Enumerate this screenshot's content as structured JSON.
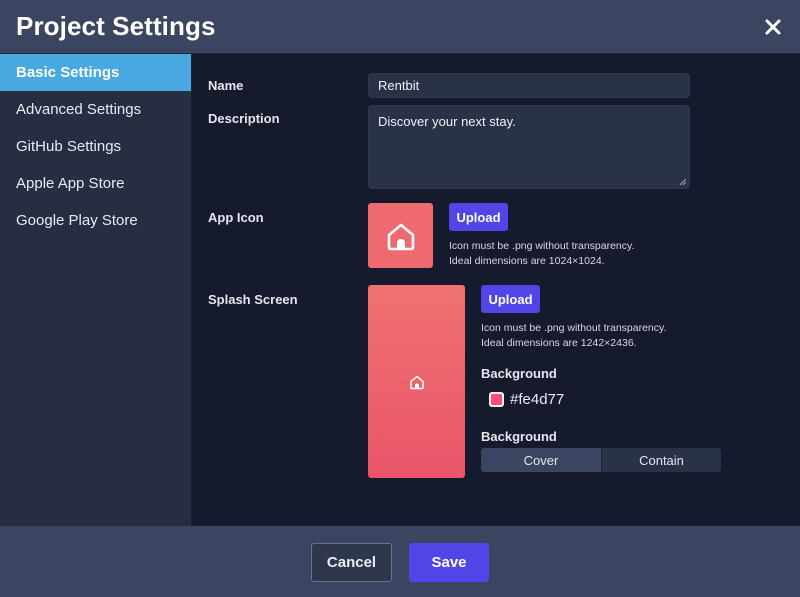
{
  "header": {
    "title": "Project Settings",
    "close_icon": "close-icon"
  },
  "sidebar": {
    "items": [
      {
        "label": "Basic Settings",
        "active": true
      },
      {
        "label": "Advanced Settings",
        "active": false
      },
      {
        "label": "GitHub Settings",
        "active": false
      },
      {
        "label": "Apple App Store",
        "active": false
      },
      {
        "label": "Google Play Store",
        "active": false
      }
    ],
    "active_color": "#4aa8e0"
  },
  "form": {
    "name": {
      "label": "Name",
      "value": "Rentbit"
    },
    "description": {
      "label": "Description",
      "value": "Discover your next stay."
    },
    "app_icon": {
      "label": "App Icon",
      "upload_label": "Upload",
      "hint_line1": "Icon must be .png without transparency.",
      "hint_line2": "Ideal dimensions are 1024×1024.",
      "icon": "house-icon"
    },
    "splash_screen": {
      "label": "Splash Screen",
      "upload_label": "Upload",
      "hint_line1": "Icon must be .png without transparency.",
      "hint_line2": "Ideal dimensions are 1242×2436.",
      "icon": "house-icon",
      "background_color_label": "Background",
      "background_color": "#fe4d77",
      "background_mode_label": "Background",
      "background_modes": [
        "Cover",
        "Contain"
      ],
      "selected_mode": "Cover"
    }
  },
  "footer": {
    "cancel_label": "Cancel",
    "save_label": "Save"
  },
  "colors": {
    "accent": "#5145e8",
    "header_bg": "#3b4460",
    "main_bg": "#151b2c",
    "sidebar_bg": "#272e42"
  }
}
